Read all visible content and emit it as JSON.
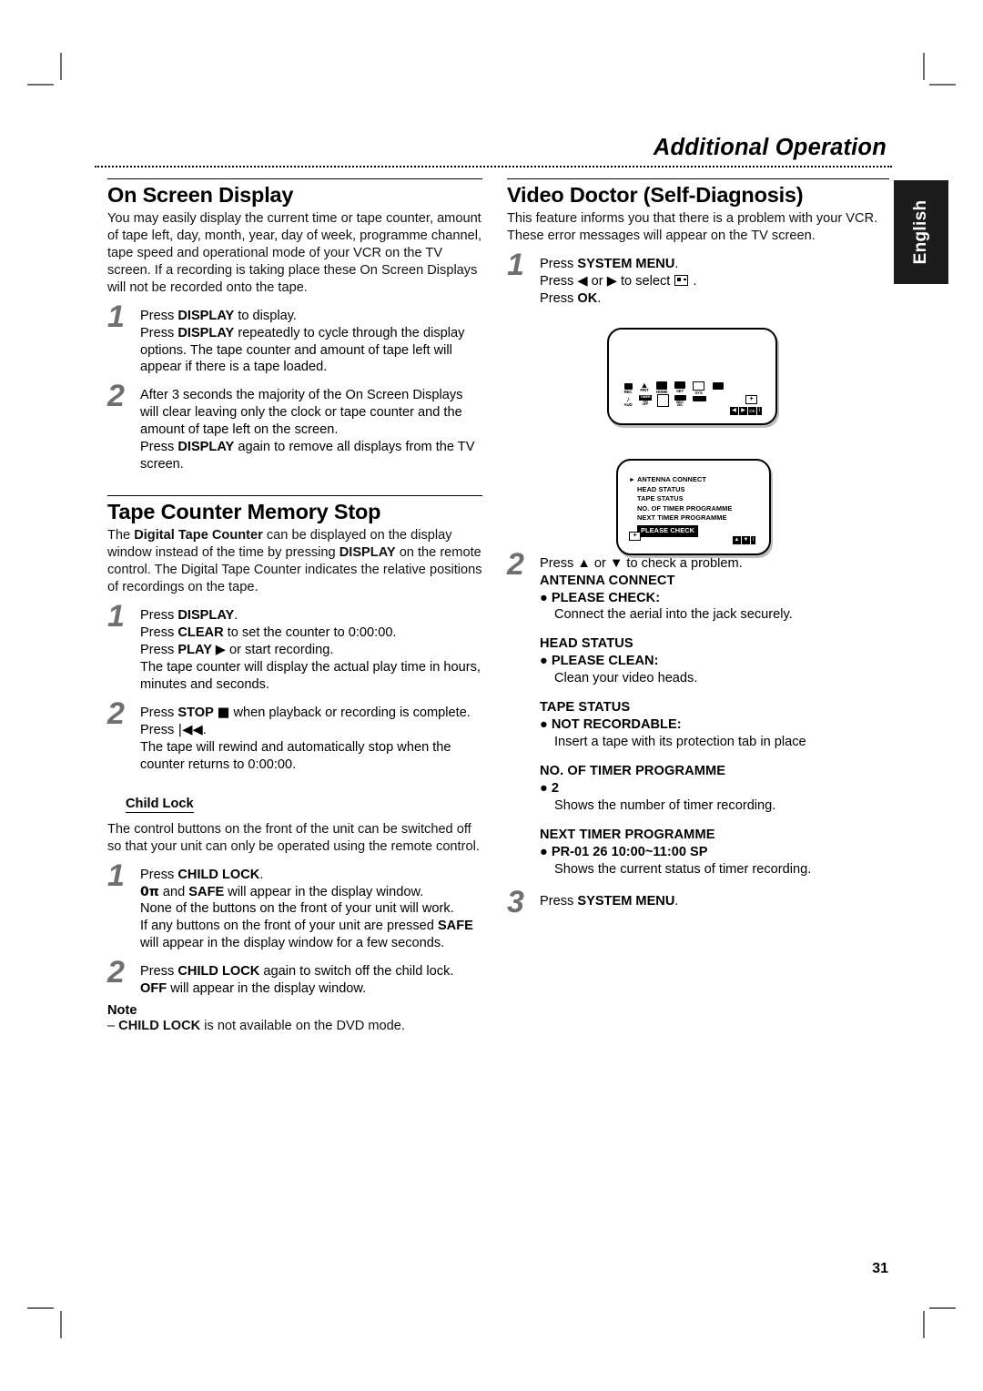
{
  "header": {
    "chapter_title": "Additional Operation",
    "language_tab": "English"
  },
  "page_number": "31",
  "left_column": {
    "section1": {
      "heading": "On Screen Display",
      "intro": "You may easily display the current time or tape counter, amount of tape left, day, month, year, day of week, programme channel, tape speed and operational mode of your VCR on the TV screen. If a recording is taking place these On Screen Displays will not be recorded onto the tape.",
      "steps": [
        {
          "num": "1",
          "lines": [
            "Press DISPLAY to display.",
            "Press DISPLAY repeatedly to cycle through the display options. The tape counter and amount of tape left will appear if there is a tape loaded."
          ]
        },
        {
          "num": "2",
          "lines": [
            "After 3 seconds the majority of the On Screen Displays will clear leaving only the clock or tape counter and the amount of tape left on the screen.",
            "Press DISPLAY again to remove all displays from the TV screen."
          ]
        }
      ]
    },
    "section2": {
      "heading": "Tape Counter Memory Stop",
      "intro": "The Digital Tape Counter can be displayed on the display window instead of the time by pressing DISPLAY on the remote control. The Digital Tape Counter indicates the relative positions of recordings on the tape.",
      "steps": [
        {
          "num": "1",
          "lines": [
            "Press DISPLAY.",
            "Press CLEAR to set the counter to 0:00:00.",
            "Press PLAY ► or start recording.",
            "The tape counter will display the actual play time in hours, minutes and seconds."
          ]
        },
        {
          "num": "2",
          "lines": [
            "Press STOP ■ when playback or recording is complete.",
            "Press |◄◄.",
            "The tape will rewind and automatically stop when the counter returns to 0:00:00."
          ]
        }
      ]
    },
    "section3": {
      "heading": "Child Lock",
      "intro": "The control buttons on the front of the unit can be switched off so that your unit can only be operated using the remote control.",
      "steps": [
        {
          "num": "1",
          "lines": [
            "Press CHILD LOCK.",
            "0π and SAFE will appear in the display window.",
            "None of the  buttons on the front of your unit will work.",
            "If any buttons on the front of your unit are pressed SAFE will appear in the display window for a few seconds."
          ]
        },
        {
          "num": "2",
          "lines": [
            "Press CHILD LOCK again to switch off the child lock.",
            "OFF will appear in the display window."
          ]
        }
      ],
      "note_label": "Note",
      "note_text": "– CHILD LOCK is not available on the DVD mode."
    }
  },
  "right_column": {
    "heading": "Video Doctor (Self-Diagnosis)",
    "intro": "This feature informs you that there is a problem with your VCR. These error messages will appear on the TV screen.",
    "step1": {
      "num": "1",
      "line1": "Press SYSTEM MENU.",
      "line2_pre": "Press ◄ or ► to select",
      "line2_post": ".",
      "line3": "Press OK."
    },
    "tv_screen_1": {
      "label": "system-menu-icons",
      "icons": [
        {
          "symbol": "♪",
          "label": "REC"
        },
        {
          "symbol": "¥",
          "label": "PR/T"
        },
        {
          "symbol": "▭",
          "label": "HOME"
        },
        {
          "symbol": "V/B",
          "label": "SET"
        },
        {
          "symbol": "□□",
          "label": "SYS"
        },
        {
          "symbol": "▣",
          "label": ""
        },
        {
          "symbol": "♫",
          "label": "AUD"
        },
        {
          "symbol": "TIMER",
          "label": "ON OFF"
        },
        {
          "symbol": "⊟",
          "label": ""
        },
        {
          "symbol": "▬",
          "label": "REC/ DEL"
        },
        {
          "symbol": "◄█►",
          "label": ""
        }
      ],
      "plus_button": "+",
      "nav_buttons": [
        "◄",
        "►",
        "OK",
        "i"
      ]
    },
    "tv_screen_2": {
      "cursor": "►",
      "items": [
        "ANTENNA CONNECT",
        "HEAD STATUS",
        "TAPE STATUS",
        "NO. OF TIMER PROGRAMME",
        "NEXT TIMER PROGRAMME"
      ],
      "highlighted": "PLEASE CHECK",
      "plus_button": "+",
      "nav_buttons": [
        "▲",
        "▼",
        "i"
      ]
    },
    "step2": {
      "num": "2",
      "intro": "Press ▲ or ▼ to check a problem.",
      "diagnostics": [
        {
          "title": "ANTENNA CONNECT",
          "bullet": "● PLEASE CHECK:",
          "desc": "Connect the aerial into the jack securely."
        },
        {
          "title": "HEAD STATUS",
          "bullet": "● PLEASE CLEAN:",
          "desc": "Clean your video heads."
        },
        {
          "title": "TAPE STATUS",
          "bullet": "● NOT RECORDABLE:",
          "desc": "Insert a tape with its protection tab in place"
        },
        {
          "title": "NO. OF TIMER PROGRAMME",
          "bullet": "● 2",
          "desc": "Shows the number of timer recording."
        },
        {
          "title": "NEXT TIMER PROGRAMME",
          "bullet": "● PR-01 26 10:00~11:00 SP",
          "desc": "Shows the current status of timer recording."
        }
      ]
    },
    "step3": {
      "num": "3",
      "line1": "Press SYSTEM MENU."
    }
  }
}
